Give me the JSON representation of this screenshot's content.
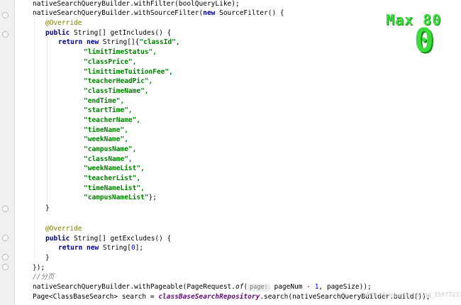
{
  "editor": {
    "l1": {
      "a": "nativeSearchQueryBuilder.withFilter(boolQueryLike);"
    },
    "l2": {
      "a": "nativeSearchQueryBuilder.withSourceFilter(",
      "b": "new",
      "c": " SourceFilter() {"
    },
    "l3": {
      "a": "@Override"
    },
    "l4": {
      "a": "public",
      "b": " String[] getIncludes() {"
    },
    "l5": {
      "a": "return new",
      "b": " String[]{",
      "c": "\"classId\"",
      "d": ","
    },
    "includes": [
      "\"limitTimeStatus\",",
      "\"classPrice\",",
      "\"limittimeTuitionFee\",",
      "\"teacherHeadPic\",",
      "\"classTimeName\",",
      "\"endTime\",",
      "\"startTime\",",
      "\"teacherName\",",
      "\"timeName\",",
      "\"weekName\",",
      "\"campusName\",",
      "\"className\",",
      "\"weekNameList\",",
      "\"teacherList\",",
      "\"timeNameList\","
    ],
    "last_include": {
      "a": "\"campusNameList\"",
      "b": "};"
    },
    "l22": {
      "a": "}"
    },
    "l24": {
      "a": "@Override"
    },
    "l25": {
      "a": "public",
      "b": " String[] getExcludes() {"
    },
    "l26": {
      "a": "return new",
      "b": " String[",
      "c": "0",
      "d": "];"
    },
    "l27": {
      "a": "}"
    },
    "l28": {
      "a": "});"
    },
    "l29": {
      "a": "//分页"
    },
    "l30": {
      "a": "nativeSearchQueryBuilder.withPageable(PageRequest.",
      "b": "of",
      "c": "(",
      "hint": "page:",
      "d": " pageNum - ",
      "e": "1",
      "f": ", pageSize));"
    },
    "l31": {
      "a": "Page<ClassBaseSearch> search = ",
      "b": "classBaseSearchRepository",
      "c": ".search(nativeSearchQueryBuilder.build());"
    }
  },
  "overlay": {
    "title": "Max 80",
    "value": "0"
  },
  "watermark": "https://blog.csdn.net/qq_35977237"
}
